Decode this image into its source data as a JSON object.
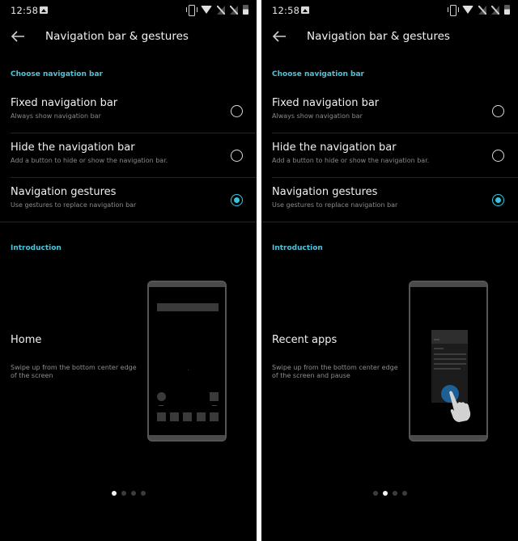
{
  "screens": [
    {
      "status_bar": {
        "time": "12:58",
        "icons": [
          "image-icon",
          "vibrate-icon",
          "wifi-icon",
          "signal-no-sim-icon",
          "signal-no-sim-icon",
          "battery-icon"
        ]
      },
      "toolbar": {
        "back_icon": "arrow-left-icon",
        "title": "Navigation bar & gestures"
      },
      "choose_section": {
        "header": "Choose navigation bar"
      },
      "options": [
        {
          "title": "Fixed navigation bar",
          "subtitle": "Always show navigation bar",
          "selected": false
        },
        {
          "title": "Hide the navigation bar",
          "subtitle": "Add a button to hide or show the navigation bar.",
          "selected": false
        },
        {
          "title": "Navigation gestures",
          "subtitle": "Use gestures to replace navigation bar",
          "selected": true
        }
      ],
      "intro_section": {
        "header": "Introduction"
      },
      "intro": {
        "title": "Home",
        "description": "Swipe up from the bottom center edge of the screen",
        "illustration": "home-screen-illustration"
      },
      "pager": {
        "count": 4,
        "active_index": 0
      }
    },
    {
      "status_bar": {
        "time": "12:58",
        "icons": [
          "image-icon",
          "vibrate-icon",
          "wifi-icon",
          "signal-no-sim-icon",
          "signal-no-sim-icon",
          "battery-icon"
        ]
      },
      "toolbar": {
        "back_icon": "arrow-left-icon",
        "title": "Navigation bar & gestures"
      },
      "choose_section": {
        "header": "Choose navigation bar"
      },
      "options": [
        {
          "title": "Fixed navigation bar",
          "subtitle": "Always show navigation bar",
          "selected": false
        },
        {
          "title": "Hide the navigation bar",
          "subtitle": "Add a button to hide or show the navigation bar.",
          "selected": false
        },
        {
          "title": "Navigation gestures",
          "subtitle": "Use gestures to replace navigation bar",
          "selected": true
        }
      ],
      "intro_section": {
        "header": "Introduction"
      },
      "intro": {
        "title": "Recent apps",
        "description": "Swipe up from the bottom center edge of the screen and pause",
        "illustration": "recent-apps-illustration"
      },
      "pager": {
        "count": 4,
        "active_index": 1
      }
    }
  ],
  "colors": {
    "accent": "#35c4e0",
    "section_header": "#4fc3d9",
    "background": "#000000",
    "touch_indicator": "#1e5f95"
  }
}
